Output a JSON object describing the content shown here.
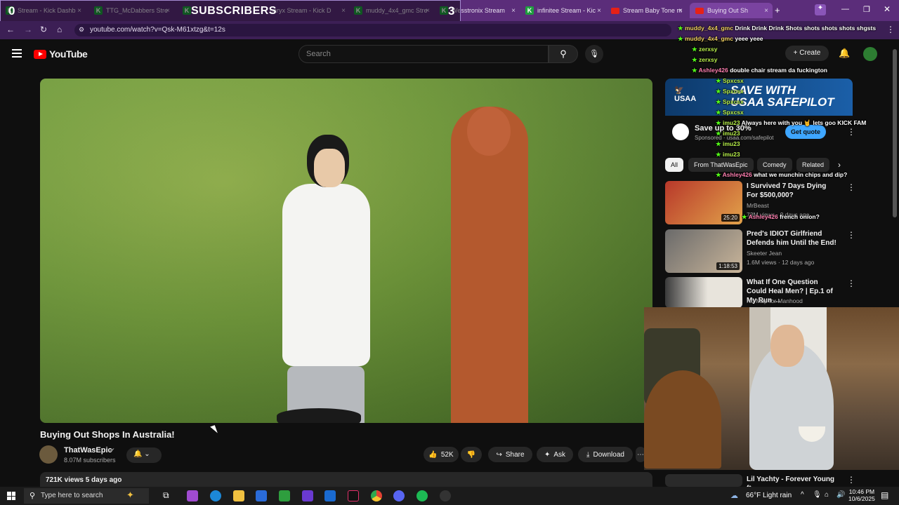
{
  "browser": {
    "tabs": [
      {
        "label": "Stream - Kick Dashb",
        "favicon": "kick-icon"
      },
      {
        "label": "TTG_McDabbers Stre",
        "favicon": "kick-icon"
      },
      {
        "label": "",
        "favicon": "kick-icon"
      },
      {
        "label": "oaryx Stream - Kick D",
        "favicon": "kick-icon"
      },
      {
        "label": "muddy_4x4_gmc Stre",
        "favicon": "kick-icon"
      },
      {
        "label": "Wesstronix Stream",
        "favicon": "kick-icon"
      },
      {
        "label": "infinitee Stream - Kic",
        "favicon": "kick-icon"
      },
      {
        "label": "Stream Baby Tone m",
        "favicon": "youtube-icon"
      },
      {
        "label": "Buying Out Sh",
        "favicon": "youtube-icon"
      }
    ],
    "url": "youtube.com/watch?v=Qsk-M61xtzg&t=12s",
    "overlay": {
      "title": "SUBSCRIBERS",
      "count_left": "0",
      "count_right": "3"
    }
  },
  "youtube": {
    "logo_text": "YouTube",
    "search_placeholder": "Search",
    "create_label": "+ Create"
  },
  "video": {
    "title": "Buying Out Shops In Australia!",
    "channel": "ThatWasEpic",
    "subscribers": "8.07M subscribers",
    "likes": "52K",
    "share": "Share",
    "ask": "Ask",
    "download": "Download",
    "views_line": "721K views  5 days ago"
  },
  "ad": {
    "brand": "USAA",
    "headline_1": "SAVE WITH",
    "headline_2": "USAA SAFEPILOT",
    "save": "Save up to 30%",
    "sponsored": "Sponsored · usaa.com/safepilot",
    "cta": "Get quote"
  },
  "chips": [
    "All",
    "From ThatWasEpic",
    "Comedy",
    "Related"
  ],
  "recommendations": [
    {
      "title": "I Survived 7 Days Dying For $500,000?",
      "channel": "MrBeast",
      "meta": "73M views · 9 days ago",
      "duration": "25:20"
    },
    {
      "title": "Pred's IDIOT Girlfriend Defends him Until the End!",
      "channel": "Skeeter Jean",
      "meta": "1.6M views · 12 days ago",
      "duration": "1:18:53"
    },
    {
      "title": "What If One Question Could Heal Men? | Ep.1 of My Run ...",
      "channel": "No Map for Manhood",
      "meta": "",
      "duration": ""
    },
    {
      "title": "Lil Yachty - Forever Young ft.",
      "channel": "",
      "meta": "",
      "duration": ""
    }
  ],
  "chat": [
    {
      "name": "muddy_4x4_gmc",
      "msg": "Drink Drink Drink Shots shots shots shots shgsts",
      "color": "y"
    },
    {
      "name": "muddy_4x4_gmc",
      "msg": "yeee yeee",
      "color": "y"
    },
    {
      "name": "zerxsy",
      "msg": "",
      "color": "g"
    },
    {
      "name": "zerxsy",
      "msg": "",
      "color": "g"
    },
    {
      "name": "Ashley426",
      "msg": "double chair stream da fuckington",
      "color": "p"
    },
    {
      "name": "Spxcsx",
      "msg": "",
      "color": "g"
    },
    {
      "name": "Spxcsx",
      "msg": "",
      "color": "g"
    },
    {
      "name": "Spxcsx",
      "msg": "",
      "color": "g"
    },
    {
      "name": "Spxcsx",
      "msg": "",
      "color": "g"
    },
    {
      "name": "imu23",
      "msg": "Always here with you 🤘 lets goo KICK FAM",
      "color": "g"
    },
    {
      "name": "imu23",
      "msg": "",
      "color": "g"
    },
    {
      "name": "imu23",
      "msg": "",
      "color": "g"
    },
    {
      "name": "imu23",
      "msg": "",
      "color": "g"
    },
    {
      "name": "Ashley426",
      "msg": "what we munchin chips and dip?",
      "color": "p"
    },
    {
      "name": "Ashley426",
      "msg": "french onion?",
      "color": "p"
    }
  ],
  "taskbar": {
    "search_placeholder": "Type here to search",
    "weather": "66°F  Light rain",
    "time": "10:46 PM",
    "date": "10/6/2025"
  }
}
